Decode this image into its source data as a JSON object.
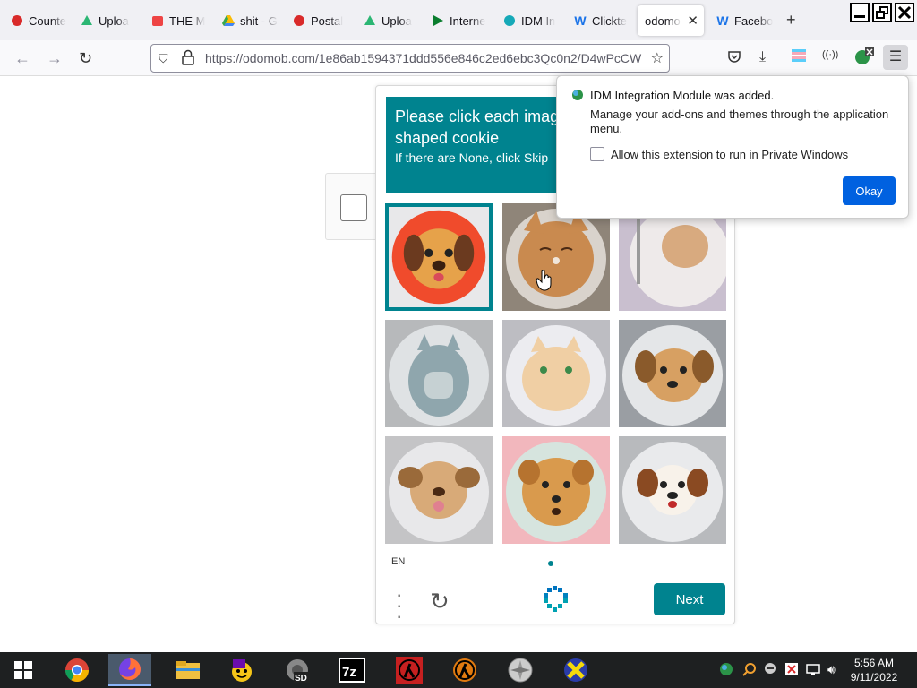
{
  "browser": {
    "tabs": [
      {
        "label": "Counte",
        "icon": "bell-red-icon"
      },
      {
        "label": "Uploa",
        "icon": "recycle-green-icon"
      },
      {
        "label": "THE M",
        "icon": "calendar-red-icon"
      },
      {
        "label": "shit - G",
        "icon": "google-drive-icon"
      },
      {
        "label": "Postal",
        "icon": "bell-red-icon"
      },
      {
        "label": "Uploa",
        "icon": "recycle-green-icon"
      },
      {
        "label": "Interne",
        "icon": "play-green-icon"
      },
      {
        "label": "IDM In",
        "icon": "idm-teal-icon"
      },
      {
        "label": "Clickte",
        "icon": "w-blue-icon"
      },
      {
        "label": "odomob",
        "icon": "",
        "active": true
      },
      {
        "label": "Facebo",
        "icon": "w-blue-icon"
      }
    ],
    "url": "https://odomob.com/1e86ab1594371ddd556e846c2ed6ebc3Qc0n2/D4wPcCW"
  },
  "challenge": {
    "prompt_main": "Please click each image containing a dog-shaped cookie",
    "prompt_sub": "If there are None, click Skip",
    "tiles": [
      {
        "desc": "dog cookie on red plate",
        "selected": true
      },
      {
        "desc": "cat cookie",
        "selected": false
      },
      {
        "desc": "cookie with spoon",
        "selected": false
      },
      {
        "desc": "grey cat cookie",
        "selected": false
      },
      {
        "desc": "cat face cookie",
        "selected": false
      },
      {
        "desc": "dog cookie",
        "selected": false
      },
      {
        "desc": "dog cookie",
        "selected": false
      },
      {
        "desc": "dog cookie on pink plate",
        "selected": false
      },
      {
        "desc": "dog cookie",
        "selected": false
      }
    ],
    "language": "EN",
    "next_label": "Next"
  },
  "popup": {
    "title": "IDM Integration Module was added.",
    "message": "Manage your add-ons and themes through the application menu.",
    "checkbox_label": "Allow this extension to run in Private Windows",
    "okay_label": "Okay"
  },
  "taskbar": {
    "apps": [
      "start-icon",
      "chrome-icon",
      "firefox-icon",
      "file-explorer-icon",
      "yahoo-messenger-icon",
      "sd-tool-icon",
      "7zip-icon",
      "half-life-icon",
      "half-life-icon",
      "compass-icon",
      "x-app-icon"
    ],
    "time": "5:56 AM",
    "date": "9/11/2022"
  },
  "colors": {
    "accent": "#00838f",
    "popup_button": "#0061e0"
  }
}
